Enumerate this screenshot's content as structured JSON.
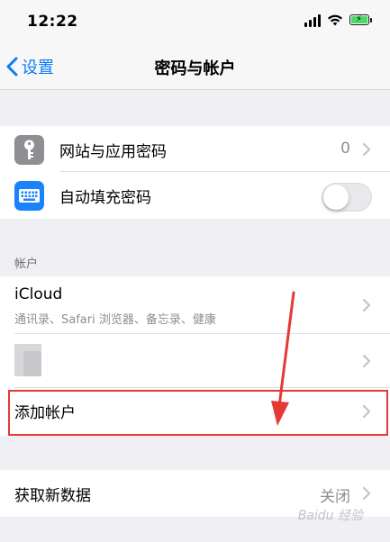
{
  "status_bar": {
    "time": "12:22"
  },
  "nav": {
    "back_label": "设置",
    "title": "密码与帐户"
  },
  "passwords_group": {
    "website_passwords": {
      "label": "网站与应用密码",
      "count": "0",
      "icon": "key-icon",
      "icon_color": "#8e8e93"
    },
    "autofill": {
      "label": "自动填充密码",
      "icon": "keyboard-icon",
      "icon_color": "#1a82fb",
      "toggle_on": false
    }
  },
  "accounts_section": {
    "header": "帐户",
    "icloud": {
      "title": "iCloud",
      "subtitle": "通讯录、Safari 浏览器、备忘录、健康"
    },
    "add_account": {
      "label": "添加帐户"
    }
  },
  "fetch_group": {
    "label": "获取新数据",
    "value": "关闭"
  },
  "watermark": "Baidu 经验",
  "colors": {
    "accent": "#0a7aff",
    "annotation": "#e53935",
    "background": "#efeff4"
  }
}
